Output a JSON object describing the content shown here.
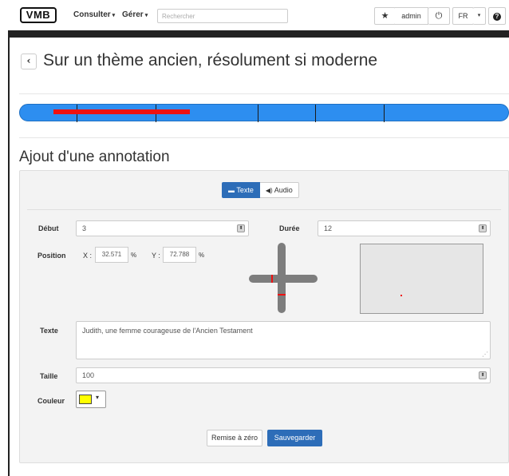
{
  "navbar": {
    "logo": "VMB",
    "menu_consulter": "Consulter",
    "menu_gerer": "Gérer",
    "search_placeholder": "Rechercher",
    "user": "admin",
    "language": "FR"
  },
  "page": {
    "back_label": "‹",
    "title": "Sur un thème ancien, résolument si moderne"
  },
  "timeline": {
    "annotation_color": "#ee1111",
    "bar_color": "#2d8ef0"
  },
  "form": {
    "section_title": "Ajout d'une annotation",
    "tab_text": "Texte",
    "tab_audio": "Audio",
    "debut_label": "Début",
    "debut_value": "3",
    "duree_label": "Durée",
    "duree_value": "12",
    "position_label": "Position",
    "x_label": "X :",
    "x_value": "32.571",
    "x_unit": "%",
    "y_label": "Y :",
    "y_value": "72.788",
    "y_unit": "%",
    "text_label": "Texte",
    "text_value": "Judith, une femme courageuse de l'Ancien Testament",
    "size_label": "Taille",
    "size_value": "100",
    "color_label": "Couleur",
    "color_value": "#ffff00",
    "reset_button": "Remise à zéro",
    "save_button": "Sauvegarder"
  }
}
